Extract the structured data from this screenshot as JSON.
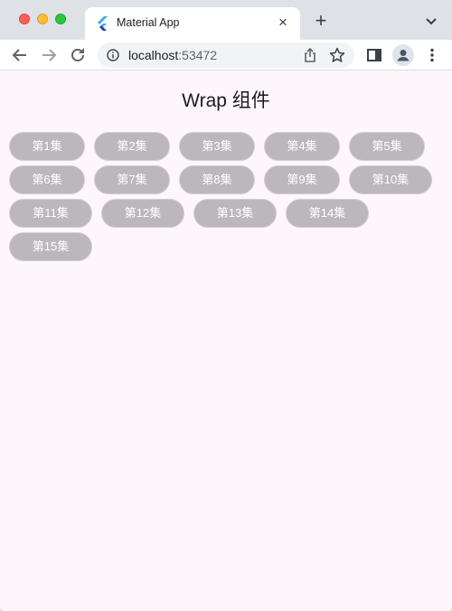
{
  "browser": {
    "tab_title": "Material App",
    "tab_close": "×",
    "new_tab": "+",
    "url_host": "localhost",
    "url_port": ":53472",
    "icons": [
      "flutter-logo-icon",
      "close-icon",
      "plus-icon",
      "chevron-down-icon",
      "back-arrow-icon",
      "forward-arrow-icon",
      "reload-icon",
      "info-icon",
      "share-icon",
      "star-icon",
      "side-panel-icon",
      "profile-icon",
      "kebab-menu-icon"
    ]
  },
  "page": {
    "title": "Wrap 组件",
    "chips": [
      "第1集",
      "第2集",
      "第3集",
      "第4集",
      "第5集",
      "第6集",
      "第7集",
      "第8集",
      "第9集",
      "第10集",
      "第11集",
      "第12集",
      "第13集",
      "第14集",
      "第15集"
    ]
  },
  "colors": {
    "chip_background": "#bcb7bd",
    "chip_text": "#ffffff",
    "page_background": "#fdf7fc",
    "title_text": "#1d1b20"
  }
}
